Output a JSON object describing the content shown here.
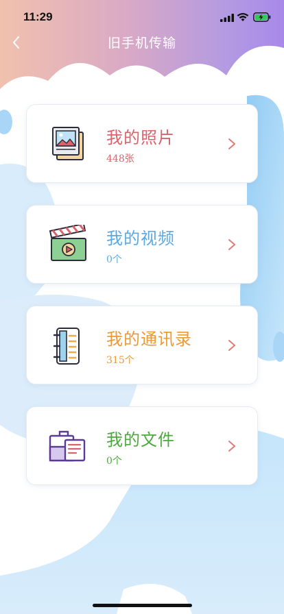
{
  "status_bar": {
    "time": "11:29"
  },
  "nav": {
    "title": "旧手机传输"
  },
  "colors": {
    "photos": "#d9636b",
    "videos": "#5aa9e6",
    "contacts": "#ec9a33",
    "files": "#4aa83c",
    "chevron": "#e07a74"
  },
  "cards": [
    {
      "title": "我的照片",
      "count": "448张",
      "icon": "photo-stack-icon"
    },
    {
      "title": "我的视频",
      "count": "0个",
      "icon": "clapperboard-icon"
    },
    {
      "title": "我的通讯录",
      "count": "315个",
      "icon": "address-book-icon"
    },
    {
      "title": "我的文件",
      "count": "0个",
      "icon": "briefcase-icon"
    }
  ]
}
